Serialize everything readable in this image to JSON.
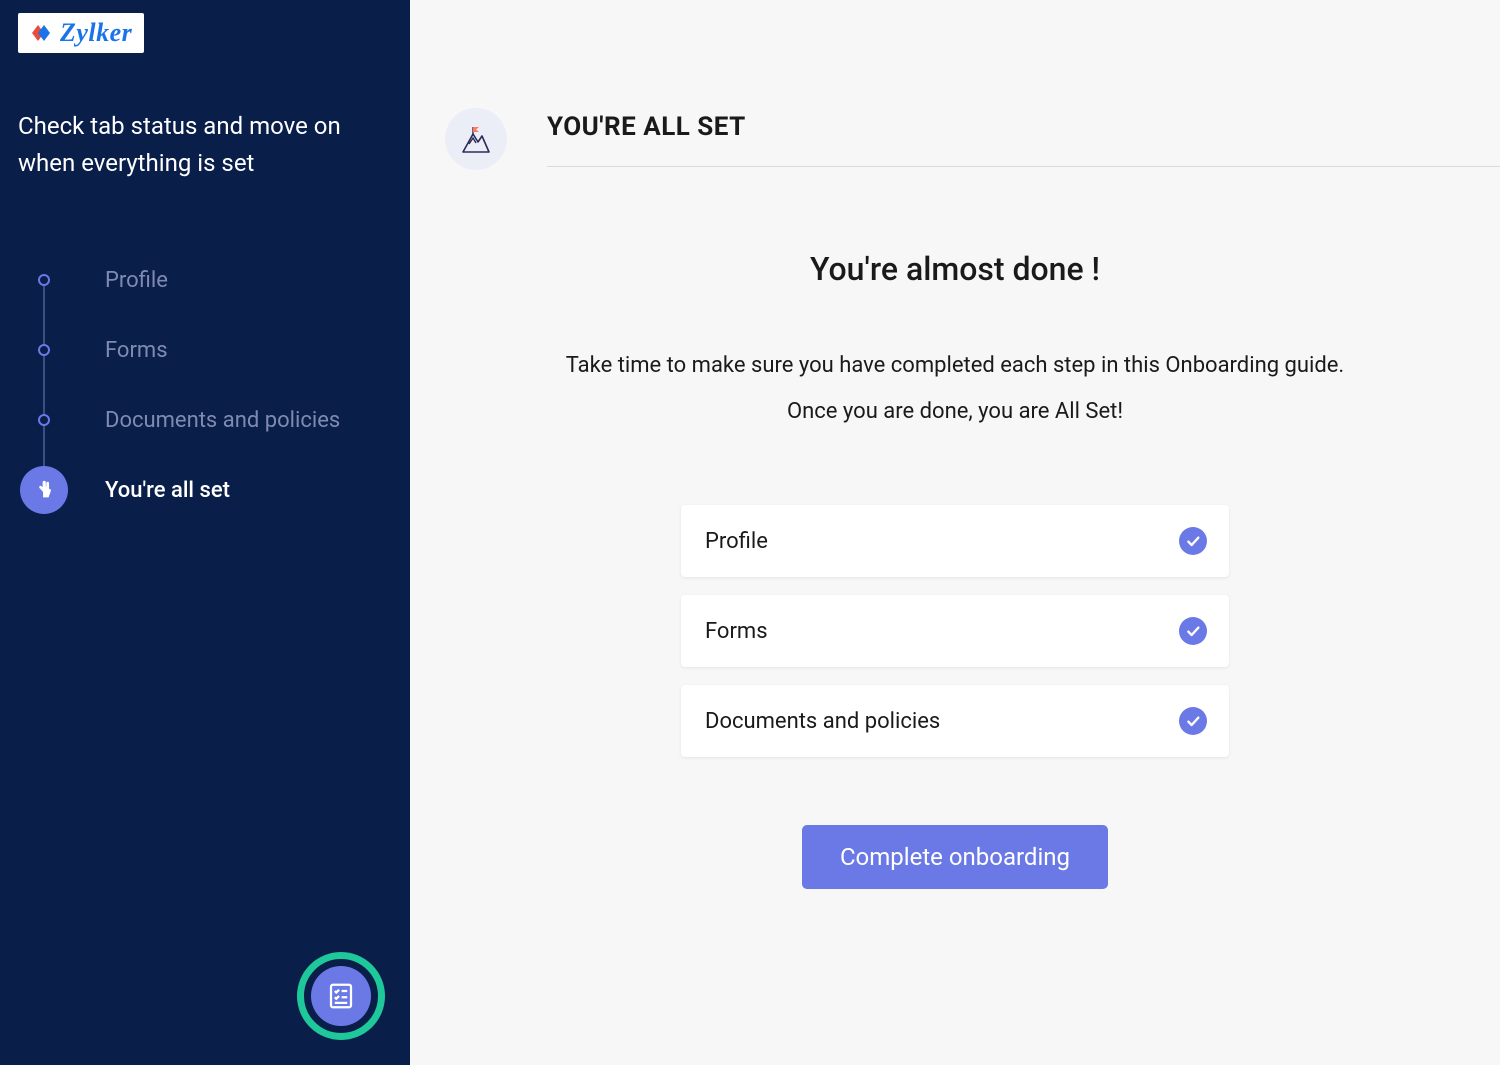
{
  "brand": {
    "name": "Zylker"
  },
  "sidebar": {
    "subtitle": "Check tab status and move on when everything is set",
    "steps": [
      {
        "label": "Profile",
        "active": false
      },
      {
        "label": "Forms",
        "active": false
      },
      {
        "label": "Documents and policies",
        "active": false
      },
      {
        "label": "You're all set",
        "active": true
      }
    ]
  },
  "page": {
    "header_title": "YOU'RE ALL SET",
    "hero_title": "You're almost done !",
    "hero_sub_line1": "Take time to make sure you have completed each step in this Onboarding guide.",
    "hero_sub_line2": "Once you are done, you are All Set!"
  },
  "checklist": [
    {
      "label": "Profile",
      "done": true
    },
    {
      "label": "Forms",
      "done": true
    },
    {
      "label": "Documents and policies",
      "done": true
    }
  ],
  "actions": {
    "complete_label": "Complete onboarding"
  }
}
